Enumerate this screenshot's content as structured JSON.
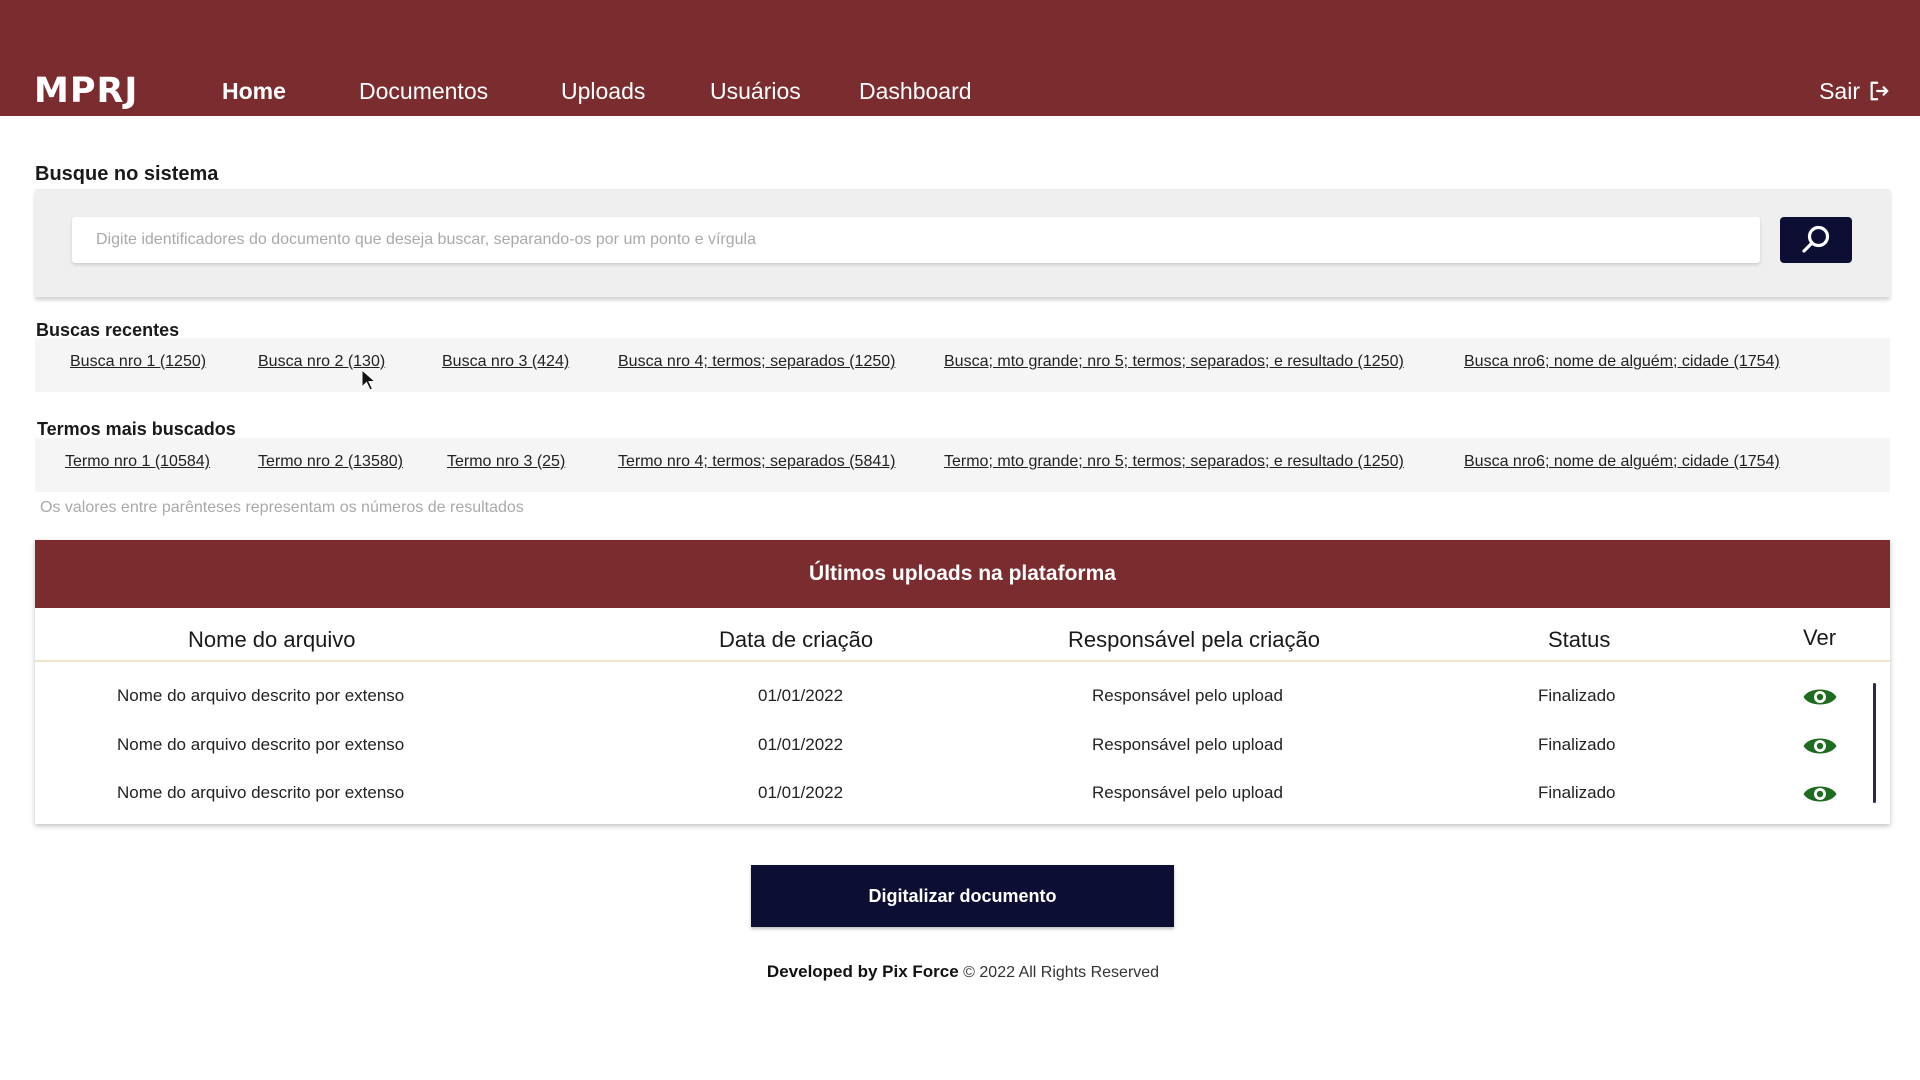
{
  "header": {
    "logo": "MPRJ",
    "nav": [
      "Home",
      "Documentos",
      "Uploads",
      "Usuários",
      "Dashboard"
    ],
    "active_nav": "Home",
    "logout_label": "Sair",
    "bg_color": "#7b2c2f"
  },
  "search": {
    "title": "Busque no sistema",
    "placeholder": "Digite identificadores do documento que deseja buscar, separando-os por um ponto e vírgula",
    "value": "",
    "button_icon": "search-icon"
  },
  "recent": {
    "title": "Buscas recentes",
    "items": [
      "Busca nro 1 (1250)",
      "Busca nro 2 (130)",
      "Busca nro 3 (424)",
      "Busca nro 4; termos; separados (1250)",
      "Busca; mto grande; nro 5; termos; separados; e resultado (1250)",
      "Busca nro6; nome de alguém; cidade (1754)"
    ]
  },
  "top_terms": {
    "title": "Termos mais buscados",
    "items": [
      "Termo nro 1 (10584)",
      "Termo nro 2 (13580)",
      "Termo nro 3 (25)",
      "Termo nro 4; termos; separados (5841)",
      "Termo; mto grande; nro 5; termos; separados; e resultado (1250)",
      "Busca nro6; nome de alguém; cidade (1754)"
    ],
    "hint": "Os valores entre parênteses representam os números de resultados"
  },
  "uploads": {
    "title": "Últimos uploads na plataforma",
    "columns": [
      "Nome do arquivo",
      "Data de criação",
      "Responsável pela criação",
      "Status",
      "Ver"
    ],
    "rows": [
      [
        "Nome do arquivo descrito por extenso",
        "01/01/2022",
        "Responsável pelo upload",
        "Finalizado"
      ],
      [
        "Nome do arquivo descrito por extenso",
        "01/01/2022",
        "Responsável pelo upload",
        "Finalizado"
      ],
      [
        "Nome do arquivo descrito por extenso",
        "01/01/2022",
        "Responsável pelo upload",
        "Finalizado"
      ]
    ],
    "view_icon": "eye-icon",
    "view_icon_color": "#1f6b1f"
  },
  "actions": {
    "digitize_label": "Digitalizar documento"
  },
  "footer": {
    "developer": "Developed by Pix Force",
    "copyright": "© 2022 All Rights Reserved"
  }
}
